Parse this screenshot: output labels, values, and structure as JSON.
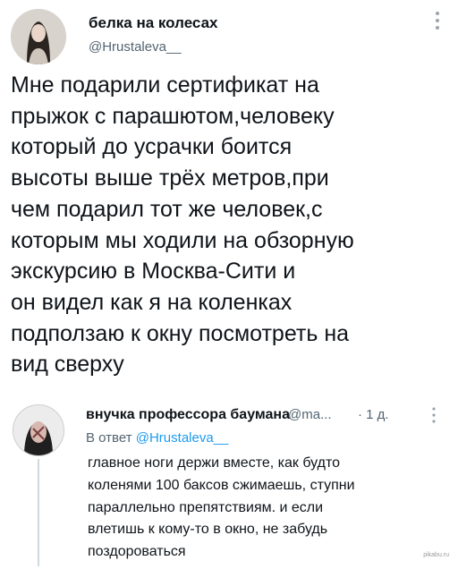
{
  "tweet": {
    "author_name": "белка на колесах",
    "author_handle": "@Hrustaleva__",
    "text_lines": [
      "Мне подарили сертификат на",
      "прыжок с парашютом,человеку",
      "который до усрачки боится",
      "высоты выше трёх метров,при",
      "чем подарил тот же человек,с",
      "которым мы ходили на обзорную",
      "экскурсию в Москва-Сити и",
      "он видел как я на коленках",
      "подползаю к окну посмотреть на",
      "вид сверху"
    ]
  },
  "reply": {
    "author_name": "внучка профессора баумана",
    "author_handle": "@ma...",
    "time": "· 1 д.",
    "reply_to_prefix": "В ответ",
    "reply_to_handle": "@Hrustaleva__",
    "text_lines": [
      "главное ноги держи вместе, как будто",
      "коленями 100 баксов сжимаешь, ступни",
      "параллельно препятствиям. и если",
      "влетишь к кому-то в окно, не забудь",
      "поздороваться"
    ]
  },
  "icons": {
    "more_main": "more-vertical-icon",
    "more_reply": "more-vertical-icon"
  },
  "watermark": "pikabu.ru"
}
